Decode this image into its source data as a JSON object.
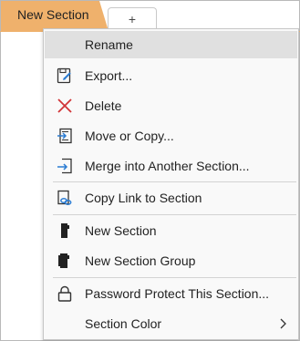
{
  "tabs": {
    "active_label": "New Section",
    "add_label": "+"
  },
  "menu": {
    "items": [
      {
        "label": "Rename",
        "icon": "rename-blank"
      },
      {
        "label": "Export...",
        "icon": "export-icon"
      },
      {
        "label": "Delete",
        "icon": "delete-x-icon"
      },
      {
        "label": "Move or Copy...",
        "icon": "move-copy-icon"
      },
      {
        "label": "Merge into Another Section...",
        "icon": "merge-icon"
      },
      {
        "label": "Copy Link to Section",
        "icon": "link-icon"
      },
      {
        "label": "New Section",
        "icon": "section-icon"
      },
      {
        "label": "New Section Group",
        "icon": "section-group-icon"
      },
      {
        "label": "Password Protect This Section...",
        "icon": "lock-icon"
      },
      {
        "label": "Section Color",
        "icon": "",
        "submenu": true
      }
    ]
  },
  "colors": {
    "tab_accent": "#efb16c",
    "delete_icon": "#d13438",
    "link_icon": "#2b7cd3",
    "highlight": "#e0e0e0"
  }
}
